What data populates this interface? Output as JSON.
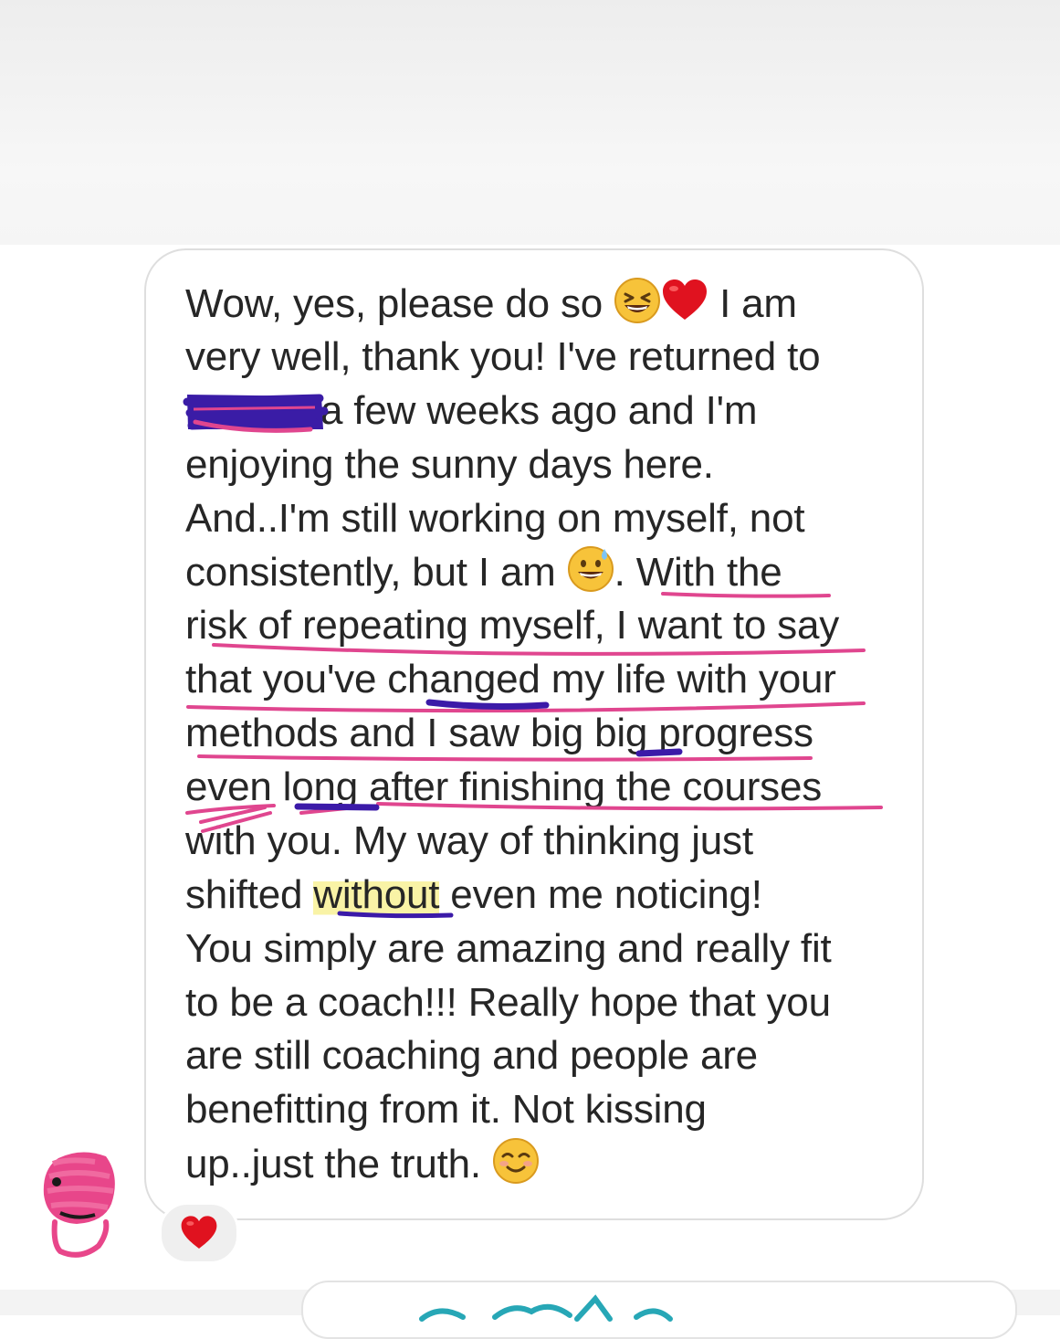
{
  "message": {
    "lines": [
      {
        "pre": "Wow, yes, please do so",
        "post": "I am"
      },
      {
        "text": "very well, thank you! I've returned to"
      },
      {
        "post": "a few weeks ago and I'm"
      },
      {
        "text": "enjoying the sunny days here."
      },
      {
        "text": "And..I'm still working on myself, not"
      },
      {
        "pre": "consistently, but I am",
        "post": ". With the"
      },
      {
        "text": "risk of repeating myself, I want to say"
      },
      {
        "text": "that you've changed my life with your"
      },
      {
        "text": "methods and I saw big big progress"
      },
      {
        "text": "even long after finishing the courses"
      },
      {
        "text": "with you. My way of thinking just"
      },
      {
        "pre": "shifted ",
        "highlight": "without",
        "post": " even me noticing!"
      },
      {
        "text": "You simply are amazing and really fit"
      },
      {
        "text": "to be a coach!!! Really hope that you"
      },
      {
        "text": "are still coaching and people are"
      },
      {
        "text": "benefitting from it. Not kissing"
      },
      {
        "pre": "up..just the truth.",
        "post": ""
      }
    ],
    "emojis": [
      "grinning-squinting-face-emoji",
      "red-heart-emoji",
      "grinning-face-with-sweat-emoji",
      "smiling-face-emoji"
    ]
  },
  "reaction": {
    "emoji": "red-heart-emoji"
  },
  "colors": {
    "text": "#262626",
    "bubble_border": "#dedede",
    "annotation_pink": "#e0468f",
    "annotation_purple": "#3b1aa8",
    "highlight_yellow": "#f9f3a6",
    "avatar_scribble": "#e8468a",
    "reaction_bg": "#efefef"
  }
}
